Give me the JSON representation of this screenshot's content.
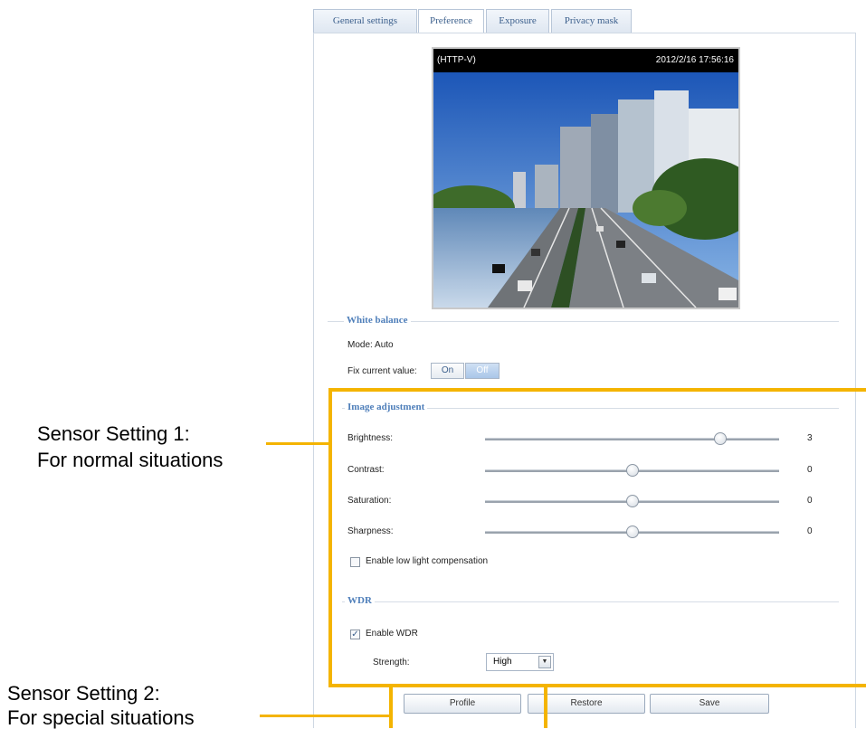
{
  "tabs": [
    {
      "label": "General settings",
      "active": false
    },
    {
      "label": "Preference",
      "active": true
    },
    {
      "label": "Exposure",
      "active": false
    },
    {
      "label": "Privacy mask",
      "active": false
    }
  ],
  "video": {
    "stream_label": "(HTTP-V)",
    "timestamp": "2012/2/16 17:56:16"
  },
  "white_balance": {
    "title": "White balance",
    "mode_text": "Mode: Auto",
    "fix_label": "Fix current value:",
    "on_label": "On",
    "off_label": "Off",
    "selected": "Off"
  },
  "image_adjustment": {
    "title": "Image adjustment",
    "sliders": [
      {
        "label": "Brightness:",
        "value": "3",
        "level": 0.8
      },
      {
        "label": "Contrast:",
        "value": "0",
        "level": 0.5
      },
      {
        "label": "Saturation:",
        "value": "0",
        "level": 0.5
      },
      {
        "label": "Sharpness:",
        "value": "0",
        "level": 0.5
      }
    ],
    "low_light_label": "Enable low light compensation",
    "low_light_checked": false
  },
  "wdr": {
    "title": "WDR",
    "enable_label": "Enable WDR",
    "enable_checked": true,
    "strength_label": "Strength:",
    "strength_value": "High"
  },
  "buttons": {
    "profile": "Profile",
    "restore": "Restore",
    "save": "Save"
  },
  "annotations": {
    "setting1_line1": "Sensor Setting 1:",
    "setting1_line2": "For normal situations",
    "setting2_line1": "Sensor Setting 2:",
    "setting2_line2": "For special situations"
  },
  "colors": {
    "accent": "#4f7fba",
    "annotation": "#f4b400"
  }
}
